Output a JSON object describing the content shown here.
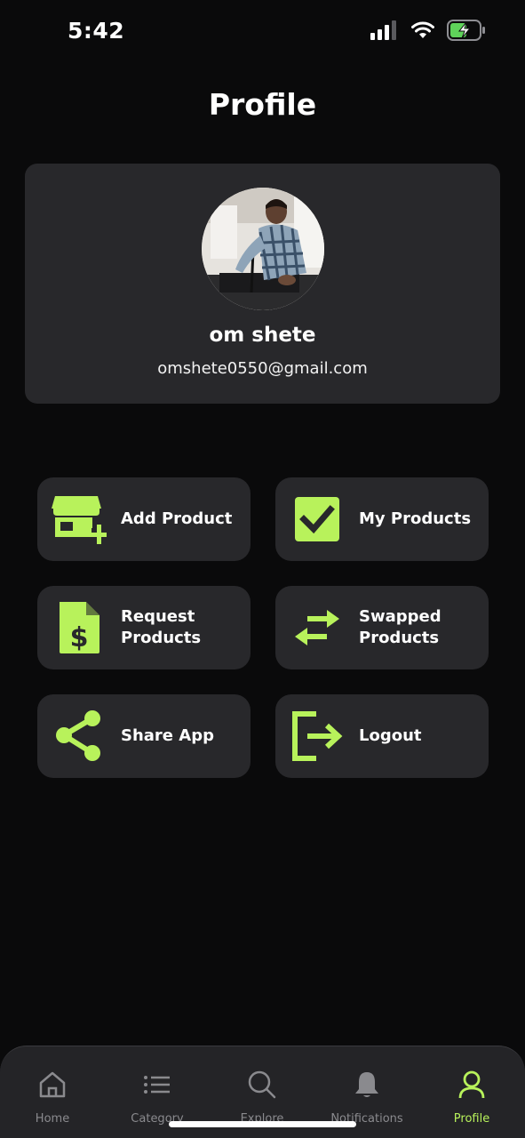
{
  "status_bar": {
    "time": "5:42"
  },
  "header": {
    "title": "Profile"
  },
  "profile": {
    "name": "om shete",
    "email": "omshete0550@gmail.com"
  },
  "actions": [
    {
      "label": "Add Product",
      "icon": "store-add-icon"
    },
    {
      "label": "My Products",
      "icon": "checkbox-icon"
    },
    {
      "label": "Request\nProducts",
      "icon": "invoice-dollar-icon"
    },
    {
      "label": "Swapped\nProducts",
      "icon": "swap-arrows-icon"
    },
    {
      "label": "Share App",
      "icon": "share-icon"
    },
    {
      "label": "Logout",
      "icon": "logout-icon"
    }
  ],
  "nav": [
    {
      "label": "Home",
      "icon": "home-icon"
    },
    {
      "label": "Category",
      "icon": "list-icon"
    },
    {
      "label": "Explore",
      "icon": "search-icon"
    },
    {
      "label": "Notifications",
      "icon": "bell-icon"
    },
    {
      "label": "Profile",
      "icon": "user-icon",
      "active": true
    }
  ],
  "colors": {
    "accent": "#b8f25b",
    "card": "#28282b",
    "background": "#0a0a0b"
  }
}
